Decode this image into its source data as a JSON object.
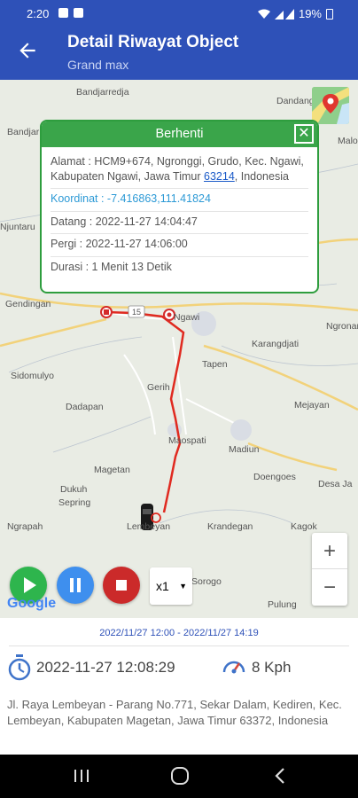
{
  "status_bar": {
    "time": "2:20",
    "battery": "19%"
  },
  "header": {
    "title": "Detail Riwayat Object",
    "subtitle": "Grand max"
  },
  "map": {
    "places": [
      "Bandjarredja",
      "Dandang",
      "Bandjar",
      "Malo",
      "Ngronan",
      "Karangdjati",
      "Tapen",
      "Gerih",
      "Sidomulyo",
      "Dadapan",
      "Mejayan",
      "Maospati",
      "Madiun",
      "Magetan",
      "Doengoes",
      "Dukuh",
      "Sepring",
      "Desa Ja",
      "Ngrapah",
      "Krandegan",
      "Kagok",
      "Pulung",
      "Gendingan",
      "Ngawi",
      "Lembeyan",
      "Njuntaru",
      "Sorogo"
    ],
    "road_labels": [
      "15"
    ],
    "route_color": "#e02a20",
    "google_logo": "Google"
  },
  "popup": {
    "title": "Berhenti",
    "address_prefix": "Alamat : HCM9+674, Ngronggi, Grudo, Kec. Ngawi, Kabupaten Ngawi, Jawa Timur ",
    "address_postcode": "63214",
    "address_suffix": ", Indonesia",
    "coordinates": "Koordinat : -7.416863,111.41824",
    "arrived": "Datang : 2022-11-27 14:04:47",
    "departed": "Pergi : 2022-11-27 14:06:00",
    "duration": "Durasi : 1 Menit 13 Detik"
  },
  "controls": {
    "speed_selected": "x1",
    "zoom_in": "+",
    "zoom_out": "−"
  },
  "info": {
    "range": "2022/11/27 12:00 - 2022/11/27 14:19",
    "timestamp": "2022-11-27 12:08:29",
    "speed": "8 Kph",
    "address": "Jl. Raya Lembeyan - Parang No.771, Sekar Dalam, Kediren, Kec. Lembeyan, Kabupaten Magetan, Jawa Timur 63372, Indonesia"
  }
}
